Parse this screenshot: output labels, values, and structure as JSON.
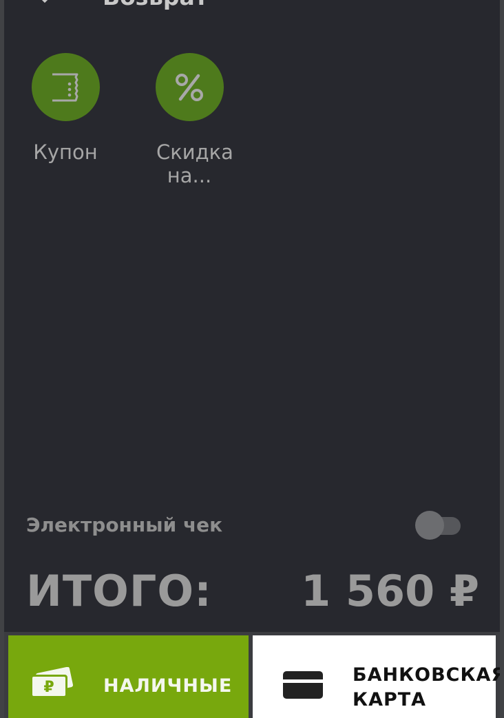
{
  "header": {
    "title": "Возврат",
    "back_icon": "arrow-back-icon"
  },
  "actions": [
    {
      "label": "Купон",
      "icon": "coupon-icon"
    },
    {
      "label": "Скидка на...",
      "icon": "percent-icon"
    }
  ],
  "echeck": {
    "label": "Электронный чек",
    "enabled": false
  },
  "total": {
    "label": "ИТОГО:",
    "value": "1 560 ₽"
  },
  "payment": {
    "cash_label": "НАЛИЧНЫЕ",
    "card_label": "БАНКОВСКАЯ КАРТА",
    "cash_icon": "cash-icon",
    "card_icon": "card-icon"
  },
  "colors": {
    "background": "#27282e",
    "accent_green": "#78a80d",
    "icon_circle": "#4e7a1c"
  }
}
